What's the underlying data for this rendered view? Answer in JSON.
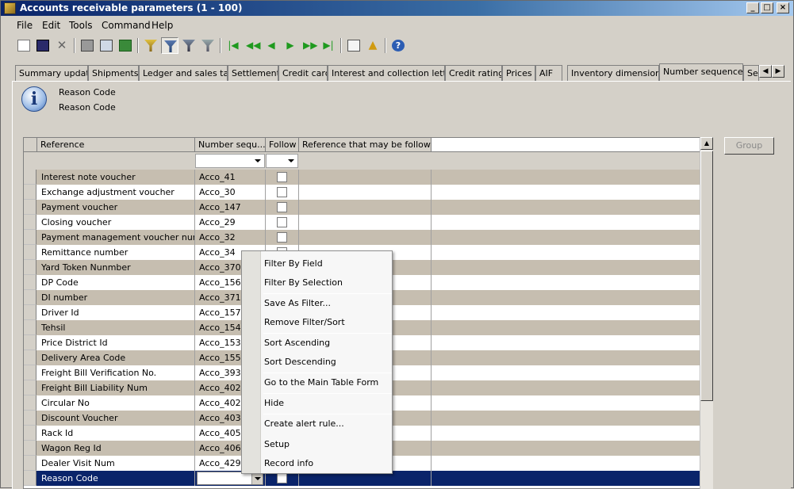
{
  "window": {
    "title": "Accounts receivable parameters (1 - 100)"
  },
  "menu": [
    "File",
    "Edit",
    "Tools",
    "Command",
    "Help"
  ],
  "toolbar": [
    {
      "name": "new-icon"
    },
    {
      "name": "save-icon"
    },
    {
      "name": "delete-icon"
    },
    {
      "name": "print-icon"
    },
    {
      "name": "print-preview-icon"
    },
    {
      "name": "export-excel-icon"
    },
    {
      "name": "filter-by-selection-icon"
    },
    {
      "name": "filter-by-grid-icon"
    },
    {
      "name": "advanced-filter-icon"
    },
    {
      "name": "remove-filter-icon"
    },
    {
      "name": "first-record-icon"
    },
    {
      "name": "previous-page-icon"
    },
    {
      "name": "previous-record-icon"
    },
    {
      "name": "next-record-icon"
    },
    {
      "name": "next-page-icon"
    },
    {
      "name": "last-record-icon"
    },
    {
      "name": "attach-document-icon"
    },
    {
      "name": "alert-icon"
    },
    {
      "name": "help-icon"
    }
  ],
  "tabs": [
    "Summary update",
    "Shipments",
    "Ledger and sales tax",
    "Settlement",
    "Credit card",
    "Interest and collection letter",
    "Credit rating",
    "Prices",
    "AIF",
    "Inventory dimensions",
    "Number sequences",
    "Se"
  ],
  "active_tab": "Number sequences",
  "info": {
    "line1": "Reason Code",
    "line2": "Reason Code"
  },
  "grid": {
    "columns": [
      "Reference",
      "Number sequ...",
      "Follow",
      "Reference that may be followed"
    ],
    "rows": [
      {
        "reference": "Interest note voucher",
        "sequence": "Acco_41"
      },
      {
        "reference": "Exchange adjustment voucher",
        "sequence": "Acco_30"
      },
      {
        "reference": "Payment voucher",
        "sequence": "Acco_147"
      },
      {
        "reference": "Closing voucher",
        "sequence": "Acco_29"
      },
      {
        "reference": "Payment management voucher number",
        "sequence": "Acco_32"
      },
      {
        "reference": "Remittance number",
        "sequence": "Acco_34"
      },
      {
        "reference": "Yard Token Nunmber",
        "sequence": "Acco_370"
      },
      {
        "reference": "DP Code",
        "sequence": "Acco_156"
      },
      {
        "reference": "DI number",
        "sequence": "Acco_371"
      },
      {
        "reference": "Driver Id",
        "sequence": "Acco_157"
      },
      {
        "reference": "Tehsil",
        "sequence": "Acco_154"
      },
      {
        "reference": "Price District Id",
        "sequence": "Acco_153"
      },
      {
        "reference": "Delivery Area Code",
        "sequence": "Acco_155"
      },
      {
        "reference": "Freight Bill Verification No.",
        "sequence": "Acco_393"
      },
      {
        "reference": "Freight Bill Liability Num",
        "sequence": "Acco_402"
      },
      {
        "reference": "Circular No",
        "sequence": "Acco_402"
      },
      {
        "reference": "Discount Voucher",
        "sequence": "Acco_403"
      },
      {
        "reference": "Rack Id",
        "sequence": "Acco_405"
      },
      {
        "reference": "Wagon Reg Id",
        "sequence": "Acco_406"
      },
      {
        "reference": "Dealer Visit Num",
        "sequence": "Acco_429"
      },
      {
        "reference": "Reason Code",
        "sequence": ""
      }
    ]
  },
  "group_button": "Group",
  "context_menu": [
    "Filter By Field",
    "Filter By Selection",
    "Save As Filter...",
    "Remove Filter/Sort",
    "Sort Ascending",
    "Sort Descending",
    "Go to the Main Table Form",
    "Hide",
    "Create alert rule...",
    "Setup",
    "Record info"
  ],
  "colors": {
    "title_start": "#0a246a",
    "selection": "#0a246a",
    "alt_row": "#c6beb0"
  }
}
